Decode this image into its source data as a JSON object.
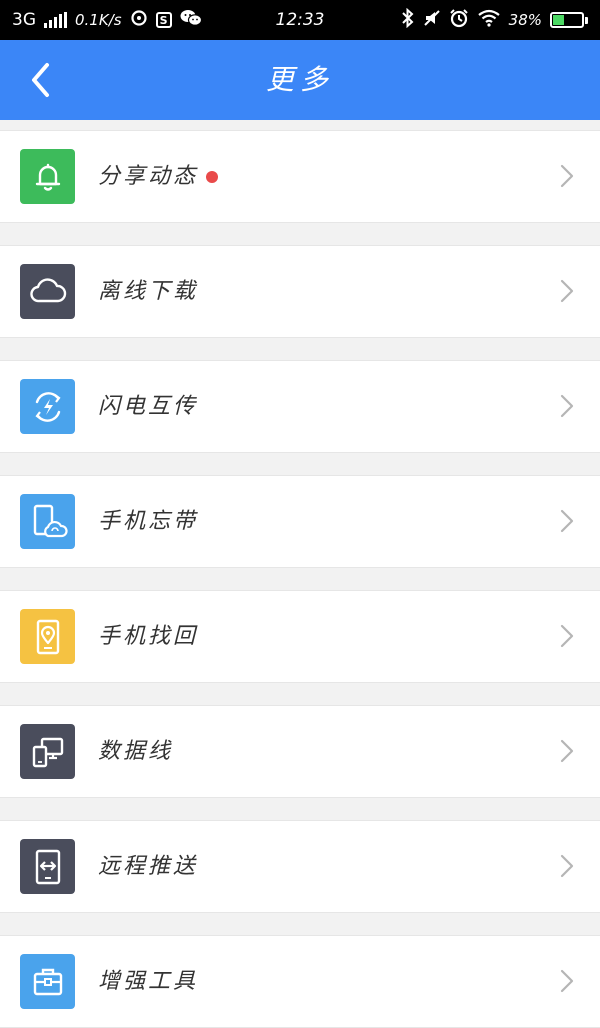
{
  "status_bar": {
    "network": "3G",
    "speed": "0.1K/s",
    "time": "12:33",
    "battery": "38%",
    "battery_level": 0.38,
    "icons": [
      "signal-icon",
      "sync-icon",
      "s-app-icon",
      "wechat-icon",
      "bluetooth-icon",
      "mute-icon",
      "alarm-icon",
      "wifi-icon",
      "battery-icon"
    ]
  },
  "nav": {
    "title": "更多",
    "back_icon": "back-arrow-icon"
  },
  "colors": {
    "nav_bg": "#3b86f7",
    "green": "#3dbb5b",
    "dark": "#4a4d5c",
    "blue": "#4aa3ec",
    "yellow": "#f5c242",
    "badge": "#e94a4a"
  },
  "menu": {
    "items": [
      {
        "label": "分享动态",
        "icon": "bell-icon",
        "badge": true
      },
      {
        "label": "离线下载",
        "icon": "cloud-icon",
        "badge": false
      },
      {
        "label": "闪电互传",
        "icon": "lightning-transfer-icon",
        "badge": false
      },
      {
        "label": "手机忘带",
        "icon": "phone-cloud-icon",
        "badge": false
      },
      {
        "label": "手机找回",
        "icon": "phone-location-icon",
        "badge": false
      },
      {
        "label": "数据线",
        "icon": "devices-icon",
        "badge": false
      },
      {
        "label": "远程推送",
        "icon": "remote-push-icon",
        "badge": false
      },
      {
        "label": "增强工具",
        "icon": "toolbox-icon",
        "badge": false
      }
    ]
  }
}
